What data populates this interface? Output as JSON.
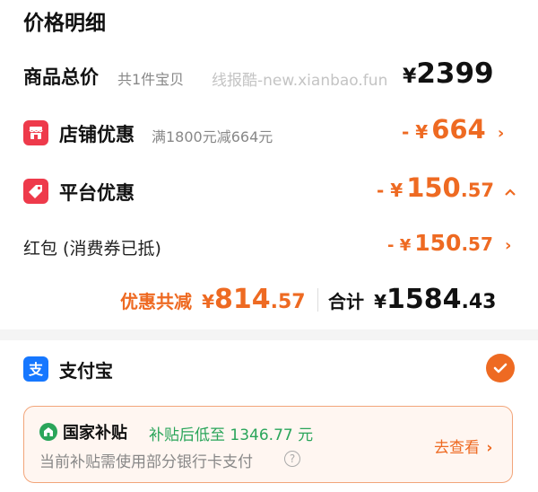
{
  "header": {
    "title": "价格明细"
  },
  "total": {
    "label": "商品总价",
    "count": "共1件宝贝",
    "watermark": "线报酷-new.xianbao.fun",
    "yen": "¥",
    "amount": "2399"
  },
  "store": {
    "label": "店铺优惠",
    "detail": "满1800元减664元",
    "prefix": "- ¥",
    "amount": "664"
  },
  "platform": {
    "label": "平台优惠",
    "prefix": "- ¥",
    "amount_int": "150",
    "amount_dec": ".57"
  },
  "redpacket": {
    "label": "红包 (消费券已抵)",
    "prefix": "- ¥",
    "amount_int": "150",
    "amount_dec": ".57"
  },
  "summary": {
    "discount_label": "优惠共减",
    "discount_yen": "¥",
    "discount_int": "814",
    "discount_dec": ".57",
    "total_label": "合计",
    "total_yen": "¥",
    "total_int": "1584",
    "total_dec": ".43"
  },
  "payment": {
    "label": "支付宝"
  },
  "subsidy": {
    "title": "国家补贴",
    "note": "补贴后低至 1346.77 元",
    "desc": "当前补贴需使用部分银行卡支付",
    "link": "去查看"
  },
  "colors": {
    "accent": "#ee6a22",
    "badge_red": "#ee3a4b",
    "alipay_blue": "#1677ff",
    "subsidy_green": "#2aa55a"
  },
  "icons": {
    "store": "store-icon",
    "coupon": "coupon-tag-icon",
    "alipay": "alipay-icon",
    "check": "check-icon",
    "gov": "subsidy-icon",
    "help": "question-circle-icon"
  }
}
